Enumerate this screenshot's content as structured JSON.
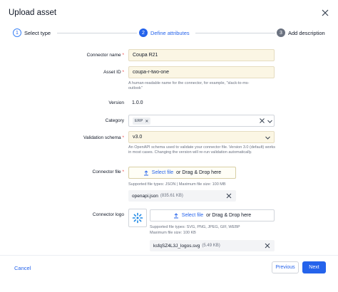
{
  "dialog": {
    "title": "Upload asset"
  },
  "stepper": {
    "steps": [
      {
        "num": "1",
        "label": "Select type"
      },
      {
        "num": "2",
        "label": "Define attributes"
      },
      {
        "num": "3",
        "label": "Add description"
      }
    ]
  },
  "form": {
    "connector_name": {
      "label": "Connector name",
      "required": "*",
      "value": "Coupa R21"
    },
    "asset_id": {
      "label": "Asset ID",
      "required": "*",
      "value": "coupa-r-two-one",
      "help": "A human-readable name for the connector, for example, \"slack-to-ms-outlook\""
    },
    "version": {
      "label": "Version",
      "value": "1.0.0"
    },
    "category": {
      "label": "Category",
      "chip": "ERP"
    },
    "validation_schema": {
      "label": "Validation schema",
      "required": "*",
      "value": "v3.0",
      "help": "An OpenAPI schema used to validate your connector file. Version 3.0 (default) works in most cases. Changing the version will re-run validation automatically."
    },
    "connector_file": {
      "label": "Connector file",
      "required": "*",
      "select_link": "Select file",
      "drop_text": "or Drag & Drop here",
      "help": "Supported file types: JSON | Maximum file size: 100 MB",
      "file_name": "openapi.json",
      "file_size": "(835.61 KB)"
    },
    "connector_logo": {
      "label": "Connector logo",
      "select_link": "Select file",
      "drop_text": "or Drag & Drop here",
      "help_line1": "Supported file types: SVG, PNG, JPEG, GIF, WEBP",
      "help_line2": "Maximum file size: 100 KB",
      "file_name": "ksfqSZ4L3J_logos.svg",
      "file_size": "(5.49 KB)"
    }
  },
  "footer": {
    "cancel": "Cancel",
    "previous": "Previous",
    "next": "Next"
  },
  "colors": {
    "primary": "#2563eb",
    "required": "#ef4444",
    "highlight_field": "#fbf6e4"
  }
}
